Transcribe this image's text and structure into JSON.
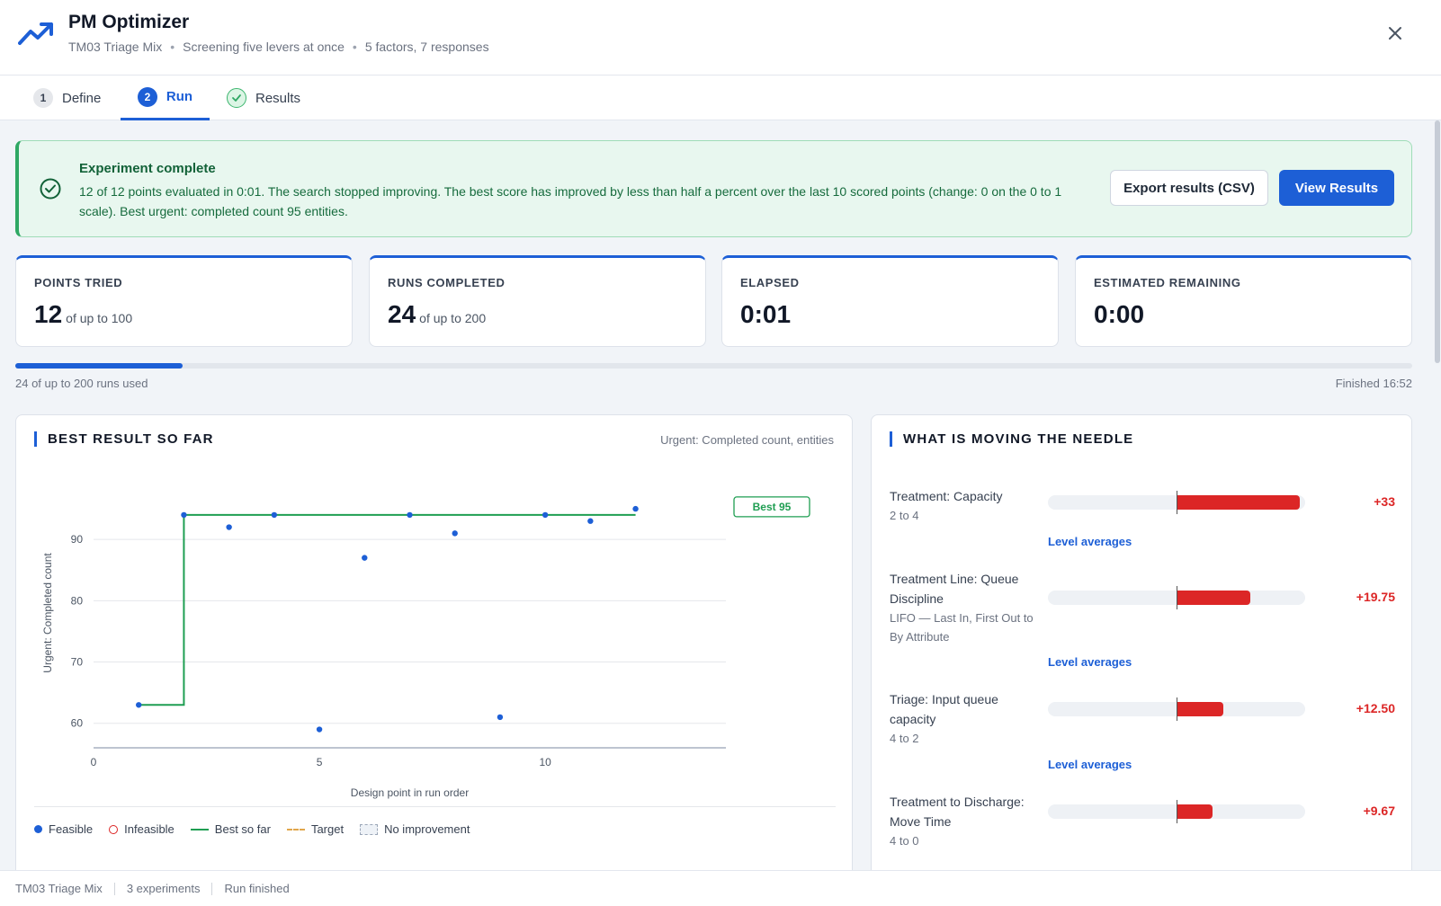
{
  "app": {
    "title": "PM Optimizer",
    "subtitle_parts": [
      "TM03 Triage Mix",
      "Screening five levers at once",
      "5 factors, 7 responses"
    ]
  },
  "tabs": [
    {
      "num": "1",
      "label": "Define"
    },
    {
      "num": "2",
      "label": "Run"
    },
    {
      "num": "✓",
      "label": "Results"
    }
  ],
  "banner": {
    "title": "Experiment complete",
    "text": "12 of 12 points evaluated in 0:01. The search stopped improving. The best score has improved by less than half a percent over the last 10 scored points (change: 0 on the 0 to 1 scale). Best urgent: completed count 95 entities.",
    "export_label": "Export results (CSV)",
    "view_label": "View Results"
  },
  "stats": [
    {
      "label": "POINTS TRIED",
      "value": "12",
      "sub": "of up to 100"
    },
    {
      "label": "RUNS COMPLETED",
      "value": "24",
      "sub": "of up to 200"
    },
    {
      "label": "ELAPSED",
      "value": "0:01",
      "sub": ""
    },
    {
      "label": "ESTIMATED REMAINING",
      "value": "0:00",
      "sub": ""
    }
  ],
  "progress": {
    "fraction": 0.12,
    "left_text": "24 of up to 200 runs used",
    "right_text": "Finished 16:52"
  },
  "best_panel": {
    "title": "BEST RESULT SO FAR",
    "note": "Urgent: Completed count, entities",
    "legend": [
      "Feasible",
      "Infeasible",
      "Best so far",
      "Target",
      "No improvement"
    ]
  },
  "chart_data": {
    "type": "scatter",
    "xlabel": "Design point in run order",
    "ylabel": "Urgent: Completed count",
    "xlim": [
      0,
      14
    ],
    "ylim": [
      56,
      100
    ],
    "x_ticks": [
      0,
      5,
      10
    ],
    "y_ticks": [
      60,
      70,
      80,
      90
    ],
    "grid": true,
    "series": [
      {
        "name": "Feasible",
        "type": "scatter",
        "x": [
          1,
          2,
          3,
          4,
          5,
          6,
          7,
          8,
          9,
          10,
          11,
          12
        ],
        "y": [
          63,
          94,
          92,
          94,
          59,
          87,
          94,
          91,
          61,
          94,
          93,
          95
        ]
      },
      {
        "name": "Best so far",
        "type": "step",
        "x": [
          1,
          2,
          3,
          4,
          5,
          6,
          7,
          8,
          9,
          10,
          11,
          12
        ],
        "y": [
          63,
          94,
          94,
          94,
          94,
          94,
          94,
          94,
          94,
          94,
          94,
          94
        ]
      }
    ],
    "annotation": "Best 95"
  },
  "needle_panel": {
    "title": "WHAT IS MOVING THE NEEDLE",
    "max_effect": 33,
    "level_link_label": "Level averages",
    "factors": [
      {
        "name": "Treatment: Capacity",
        "range": "2 to 4",
        "effect": 33,
        "label": "+33"
      },
      {
        "name": "Treatment Line: Queue Discipline",
        "range": "LIFO — Last In, First Out to By Attribute",
        "effect": 19.75,
        "label": "+19.75"
      },
      {
        "name": "Triage: Input queue capacity",
        "range": "4 to 2",
        "effect": 12.5,
        "label": "+12.50"
      },
      {
        "name": "Treatment to Discharge: Move Time",
        "range": "4 to 0",
        "effect": 9.67,
        "label": "+9.67"
      }
    ]
  },
  "footer": [
    "TM03 Triage Mix",
    "3 experiments",
    "Run finished"
  ],
  "colors": {
    "accent": "#1d5fd6",
    "success": "#2fa864",
    "best_line": "#1f9e52",
    "effect_bar": "#dc2626"
  }
}
